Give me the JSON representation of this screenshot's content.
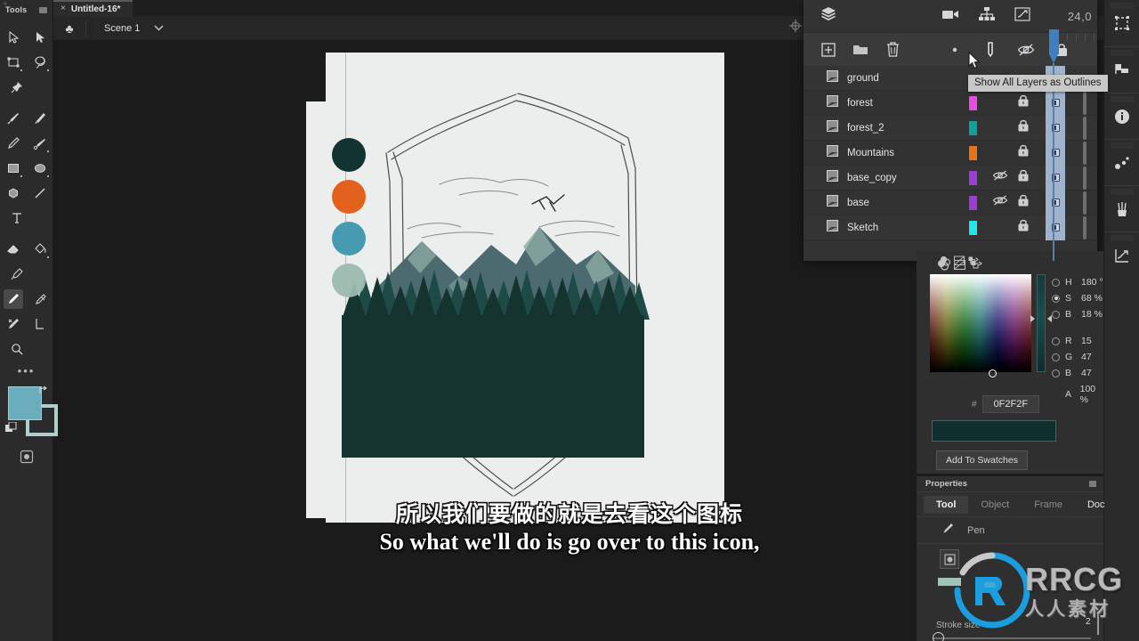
{
  "app": {
    "tools_panel_title": "Tools",
    "tab_title": "Untitled-16*",
    "tab_close": "×",
    "scene_name": "Scene 1",
    "scene_chevron": "⌄"
  },
  "toolbar": {
    "tools": [
      {
        "name": "select-tool",
        "label": "Select"
      },
      {
        "name": "direct-select-tool",
        "label": "Direct Select"
      },
      {
        "name": "transform-tool",
        "label": "Transform"
      },
      {
        "name": "lasso-tool",
        "label": "Lasso"
      },
      {
        "name": "pin-tool",
        "label": "Pin"
      },
      {
        "name": "brush-tool",
        "label": "Brush"
      },
      {
        "name": "paintbrush-tool",
        "label": "Paintbrush"
      },
      {
        "name": "pencil-tool",
        "label": "Pencil"
      },
      {
        "name": "blob-brush-tool",
        "label": "Blob Brush"
      },
      {
        "name": "rectangle-tool",
        "label": "Rectangle"
      },
      {
        "name": "ellipse-tool",
        "label": "Ellipse"
      },
      {
        "name": "polygon-tool",
        "label": "Polygon"
      },
      {
        "name": "line-tool",
        "label": "Line"
      },
      {
        "name": "type-tool",
        "label": "Type"
      },
      {
        "name": "eraser-tool",
        "label": "Eraser"
      },
      {
        "name": "paint-bucket-tool",
        "label": "Paint Bucket"
      },
      {
        "name": "eyedropper-tool",
        "label": "Eyedropper"
      },
      {
        "name": "pen-tool",
        "label": "Pen"
      },
      {
        "name": "add-anchor-tool",
        "label": "Add Anchor Point"
      },
      {
        "name": "scissors-tool",
        "label": "Scissors"
      },
      {
        "name": "corner-tool",
        "label": "Corner"
      },
      {
        "name": "zoom-tool",
        "label": "Zoom"
      }
    ],
    "more_label": "•••",
    "fill_color": "#6aaebd",
    "stroke_color": "#aecfca"
  },
  "layers_panel": {
    "title_icon": "layers-stack-icon",
    "frame_number": "24,0",
    "header_icons": [
      "camera-icon",
      "hierarchy-icon",
      "graph-editor-icon"
    ],
    "toolbar_buttons": [
      {
        "name": "add-layer-button",
        "label": "Add Layer"
      },
      {
        "name": "add-folder-button",
        "label": "New Folder"
      },
      {
        "name": "delete-layer-button",
        "label": "Delete"
      },
      {
        "name": "onion-skin-dot",
        "label": "Onion Skin"
      },
      {
        "name": "show-outlines-button",
        "label": "Show All Layers as Outlines"
      },
      {
        "name": "hide-all-button",
        "label": "Hide All Layers"
      },
      {
        "name": "lock-all-button",
        "label": "Lock All Layers"
      }
    ],
    "tooltip": "Show All Layers as Outlines",
    "columns": [
      "name",
      "color",
      "visibility",
      "lock",
      "timeline"
    ],
    "layers": [
      {
        "name": "ground",
        "color": "",
        "hidden": false,
        "locked": false,
        "has_keyframe": false
      },
      {
        "name": "forest",
        "color": "#e44ee4",
        "hidden": false,
        "locked": true,
        "has_keyframe": true
      },
      {
        "name": "forest_2",
        "color": "#12a09a",
        "hidden": false,
        "locked": true,
        "has_keyframe": true
      },
      {
        "name": "Mountains",
        "color": "#e8731b",
        "hidden": false,
        "locked": true,
        "has_keyframe": true
      },
      {
        "name": "base_copy",
        "color": "#9b3fd4",
        "hidden": true,
        "locked": true,
        "has_keyframe": true
      },
      {
        "name": "base",
        "color": "#9b3fd4",
        "hidden": true,
        "locked": true,
        "has_keyframe": true
      },
      {
        "name": "Sketch",
        "color": "#22e8ee",
        "hidden": false,
        "locked": true,
        "has_keyframe": true
      }
    ]
  },
  "color_panel": {
    "mode_tiles": [
      "fill-stroke-icon",
      "no-color-icon",
      "swap-color-icon"
    ],
    "hsb": [
      {
        "key": "H",
        "value": "180 °",
        "selected": false
      },
      {
        "key": "S",
        "value": "68 %",
        "selected": true
      },
      {
        "key": "B",
        "value": "18 %",
        "selected": false
      }
    ],
    "rgba": [
      {
        "key": "R",
        "value": "15",
        "selected": false,
        "radio": true
      },
      {
        "key": "G",
        "value": "47",
        "selected": false,
        "radio": true
      },
      {
        "key": "B",
        "value": "47",
        "selected": false,
        "radio": true
      },
      {
        "key": "A",
        "value": "100 %",
        "selected": false,
        "radio": false
      }
    ],
    "hex_symbol": "#",
    "hex_value": "0F2F2F",
    "preview_color": "#0F2F2F",
    "add_to_swatches_label": "Add To Swatches"
  },
  "properties_panel": {
    "title": "Properties",
    "tabs": [
      {
        "label": "Tool",
        "active": true
      },
      {
        "label": "Object",
        "active": false
      },
      {
        "label": "Frame",
        "active": false
      },
      {
        "label": "Doc",
        "active": false
      }
    ],
    "current_tool": "Pen",
    "stroke_label": "Stroke size",
    "stroke_value": "2"
  },
  "rail": {
    "items": [
      {
        "name": "transform-panel-icon"
      },
      {
        "name": "align-panel-icon"
      },
      {
        "name": "info-panel-icon"
      },
      {
        "name": "scatter-panel-icon"
      },
      {
        "name": "brushes-panel-icon"
      },
      {
        "name": "graph-panel-icon"
      }
    ]
  },
  "canvas": {
    "palette_dots": [
      "#113332",
      "#e2611c",
      "#469bb0",
      "#9cb9af"
    ],
    "artwork_colors": {
      "paper": "#eceeed",
      "mountain_dark": "#4c6b70",
      "mountain_mid": "#5d7b82",
      "mountain_light": "#8fada5",
      "forest_dark": "#16342f",
      "forest_mid": "#1d4a46"
    }
  },
  "subtitles": {
    "chinese": "所以我们要做的就是去看这个图标",
    "english": "So what we'll do is go over to this icon,"
  },
  "watermark": {
    "brand": "RRCG",
    "subtitle": "人人素材",
    "color": "#1a9ee0"
  }
}
